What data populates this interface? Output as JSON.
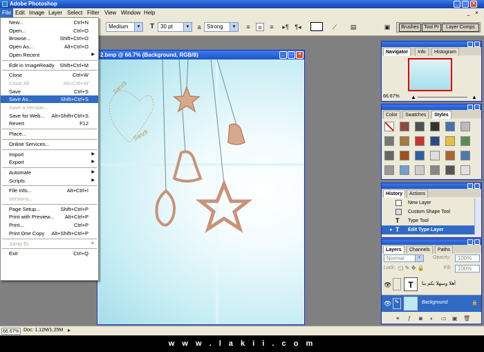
{
  "app": {
    "title": "Adobe Photoshop"
  },
  "menubar": [
    "File",
    "Edit",
    "Image",
    "Layer",
    "Select",
    "Filter",
    "View",
    "Window",
    "Help"
  ],
  "options": {
    "font_style": "Medium",
    "font_size": "30 pt",
    "aa_label": "a",
    "antialias": "Strong",
    "palette_well": [
      "Brushes",
      "Tool Pr",
      "Layer Comps"
    ]
  },
  "document": {
    "title": "2.bmp @ 66.7% (Background, RGB/8)"
  },
  "file_menu": [
    {
      "label": "New...",
      "shortcut": "Ctrl+N"
    },
    {
      "label": "Open...",
      "shortcut": "Ctrl+O"
    },
    {
      "label": "Browse...",
      "shortcut": "Shift+Ctrl+O"
    },
    {
      "label": "Open As...",
      "shortcut": "Alt+Ctrl+O"
    },
    {
      "label": "Open Recent",
      "submenu": true
    },
    {
      "sep": true
    },
    {
      "label": "Edit in ImageReady",
      "shortcut": "Shift+Ctrl+M"
    },
    {
      "sep": true
    },
    {
      "label": "Close",
      "shortcut": "Ctrl+W"
    },
    {
      "label": "Close All",
      "shortcut": "Alt+Ctrl+W",
      "disabled": true
    },
    {
      "label": "Save",
      "shortcut": "Ctrl+S"
    },
    {
      "label": "Save As...",
      "shortcut": "Shift+Ctrl+S",
      "selected": true
    },
    {
      "label": "Save a Version...",
      "disabled": true
    },
    {
      "label": "Save for Web...",
      "shortcut": "Alt+Shift+Ctrl+S"
    },
    {
      "label": "Revert",
      "shortcut": "F12"
    },
    {
      "sep": true
    },
    {
      "label": "Place..."
    },
    {
      "sep": true
    },
    {
      "label": "Online Services..."
    },
    {
      "sep": true
    },
    {
      "label": "Import",
      "submenu": true
    },
    {
      "label": "Export",
      "submenu": true
    },
    {
      "sep": true
    },
    {
      "label": "Automate",
      "submenu": true
    },
    {
      "label": "Scripts",
      "submenu": true
    },
    {
      "sep": true
    },
    {
      "label": "File Info...",
      "shortcut": "Alt+Ctrl+I"
    },
    {
      "label": "Versions...",
      "disabled": true
    },
    {
      "sep": true
    },
    {
      "label": "Page Setup...",
      "shortcut": "Shift+Ctrl+P"
    },
    {
      "label": "Print with Preview...",
      "shortcut": "Alt+Ctrl+P"
    },
    {
      "label": "Print...",
      "shortcut": "Ctrl+P"
    },
    {
      "label": "Print One Copy",
      "shortcut": "Alt+Shift+Ctrl+P"
    },
    {
      "sep": true
    },
    {
      "label": "Jump To",
      "submenu": true,
      "disabled": true
    },
    {
      "sep": true
    },
    {
      "label": "Exit",
      "shortcut": "Ctrl+Q"
    }
  ],
  "navigator": {
    "tabs": [
      "Navigator",
      "Info",
      "Histogram"
    ],
    "zoom": "66.67%"
  },
  "styles": {
    "tabs": [
      "Color",
      "Swatches",
      "Styles"
    ]
  },
  "history": {
    "tabs": [
      "History",
      "Actions"
    ],
    "items": [
      "New Layer",
      "Custom Shape Tool",
      "Type Tool",
      "Edit Type Layer"
    ]
  },
  "layers": {
    "tabs": [
      "Layers",
      "Channels",
      "Paths"
    ],
    "blend_mode": "Normal",
    "opacity_label": "Opacity:",
    "opacity": "100%",
    "lock_label": "Lock:",
    "fill_label": "Fill:",
    "fill": "100%",
    "items": [
      {
        "name": "أهلا وسهلا بكم بنا",
        "thumb": "T"
      },
      {
        "name": "Background"
      }
    ]
  },
  "canvas_text": [
    "Sanz9",
    "Sanz9"
  ],
  "status": {
    "zoom": "66.67%",
    "doc": "Doc: 1.12M/1.25M"
  },
  "footer": "w w w . l a k i i . c o m"
}
